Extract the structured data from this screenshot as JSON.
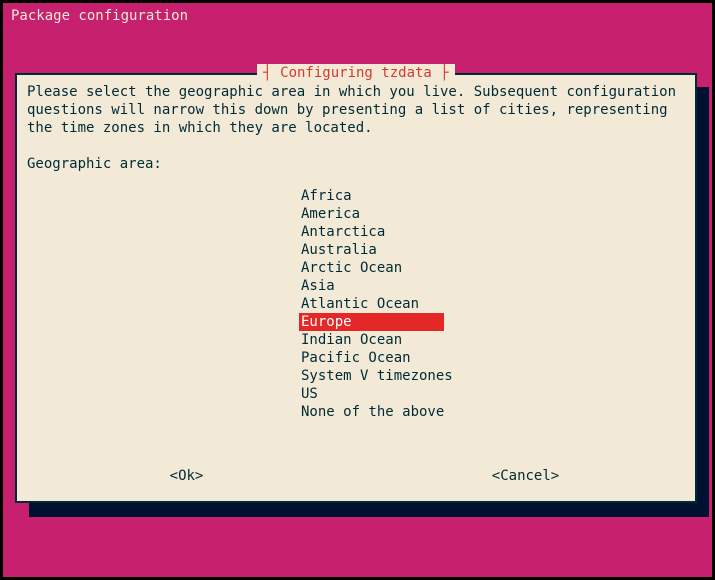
{
  "screen": {
    "title": "Package configuration"
  },
  "dialog": {
    "title_decorated": "┤ Configuring tzdata ├",
    "intro": "Please select the geographic area in which you live. Subsequent configuration questions will narrow this down by presenting a list of cities, representing the time zones in which they are located.",
    "prompt": "Geographic area:",
    "items": [
      "Africa",
      "America",
      "Antarctica",
      "Australia",
      "Arctic Ocean",
      "Asia",
      "Atlantic Ocean",
      "Europe",
      "Indian Ocean",
      "Pacific Ocean",
      "System V timezones",
      "US",
      "None of the above"
    ],
    "selected_index": 7,
    "ok_label": "<Ok>",
    "cancel_label": "<Cancel>"
  },
  "colors": {
    "background": "#c6206e",
    "panel": "#f2e9d7",
    "text": "#002b36",
    "accent": "#d33b2f",
    "highlight": "#e42828",
    "shadow": "#001030"
  }
}
